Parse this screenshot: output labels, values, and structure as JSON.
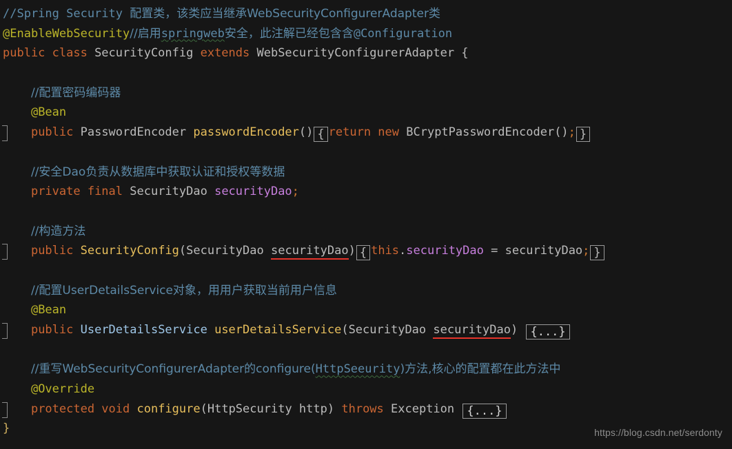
{
  "editor": {
    "background_color": "#161616",
    "default_text_color": "#bcbcbc",
    "language": "java",
    "palette": {
      "comment": "#5d8aa8",
      "keyword": "#cc6633",
      "annotation": "#bbb529",
      "class_name": "#9fc7e8",
      "method_name": "#e8bf5c",
      "field_name": "#c77fdd",
      "plain": "#bcbcbc",
      "error_underline": "#e8342b",
      "spell_underline": "#3d6b3d",
      "fold_border": "#9a9a9a",
      "watermark": "#8c8c8c"
    }
  },
  "code": {
    "lines": [
      {
        "id": "line-1",
        "tokens": [
          {
            "t": "//Spring Security ",
            "c": "cmt"
          },
          {
            "t": "配置类，该类应当继承WebSecurityConfigurerAdapter类",
            "c": "cmt cjk"
          }
        ]
      },
      {
        "id": "line-2",
        "tokens": [
          {
            "t": "@EnableWebSecurity",
            "c": "ann"
          },
          {
            "t": "//启用",
            "c": "cmt cjk"
          },
          {
            "t": "springweb",
            "c": "cmt wavy-green"
          },
          {
            "t": "安全，此注解已经包含含",
            "c": "cmt cjk"
          },
          {
            "t": "@Configuration",
            "c": "cmt"
          }
        ]
      },
      {
        "id": "line-3",
        "tokens": [
          {
            "t": "public class ",
            "c": "kw"
          },
          {
            "t": "SecurityConfig ",
            "c": "plain"
          },
          {
            "t": "extends ",
            "c": "kw"
          },
          {
            "t": "WebSecurityConfigurerAdapter ",
            "c": "plain"
          },
          {
            "t": "{",
            "c": "plain"
          }
        ]
      },
      {
        "id": "line-4",
        "tokens": []
      },
      {
        "id": "line-5",
        "indent": 4,
        "tokens": [
          {
            "t": "//配置密码编码器",
            "c": "cmt cjk"
          }
        ]
      },
      {
        "id": "line-6",
        "indent": 4,
        "tokens": [
          {
            "t": "@Bean",
            "c": "ann"
          }
        ]
      },
      {
        "id": "line-7",
        "indent": 4,
        "fold_marker": true,
        "tokens": [
          {
            "t": "public ",
            "c": "kw"
          },
          {
            "t": "PasswordEncoder ",
            "c": "plain"
          },
          {
            "t": "passwordEncoder",
            "c": "mname"
          },
          {
            "t": "()",
            "c": "plain"
          },
          {
            "t": "{",
            "c": "bracebox"
          },
          {
            "t": "return ",
            "c": "kw"
          },
          {
            "t": "new ",
            "c": "kw"
          },
          {
            "t": "BCryptPasswordEncoder",
            "c": "plain"
          },
          {
            "t": "()",
            "c": "plain"
          },
          {
            "t": ";",
            "c": "semi"
          },
          {
            "t": "}",
            "c": "bracebox"
          }
        ]
      },
      {
        "id": "line-8",
        "tokens": []
      },
      {
        "id": "line-9",
        "indent": 4,
        "tokens": [
          {
            "t": "//安全Dao负责从数据库中获取认证和授权等数据",
            "c": "cmt cjk"
          }
        ]
      },
      {
        "id": "line-10",
        "indent": 4,
        "tokens": [
          {
            "t": "private final ",
            "c": "kw"
          },
          {
            "t": "SecurityDao ",
            "c": "plain"
          },
          {
            "t": "securityDao",
            "c": "fld"
          },
          {
            "t": ";",
            "c": "semi"
          }
        ]
      },
      {
        "id": "line-11",
        "tokens": []
      },
      {
        "id": "line-12",
        "indent": 4,
        "tokens": [
          {
            "t": "//构造方法",
            "c": "cmt cjk"
          }
        ]
      },
      {
        "id": "line-13",
        "indent": 4,
        "fold_marker": true,
        "tokens": [
          {
            "t": "public ",
            "c": "kw"
          },
          {
            "t": "SecurityConfig",
            "c": "mname"
          },
          {
            "t": "(",
            "c": "plain"
          },
          {
            "t": "SecurityDao ",
            "c": "plain"
          },
          {
            "t": "securityDao",
            "c": "plain err-underline"
          },
          {
            "t": ")",
            "c": "plain"
          },
          {
            "t": "{",
            "c": "bracebox"
          },
          {
            "t": "this",
            "c": "kw"
          },
          {
            "t": ".",
            "c": "plain"
          },
          {
            "t": "securityDao",
            "c": "fld"
          },
          {
            "t": " = securityDao",
            "c": "plain"
          },
          {
            "t": ";",
            "c": "semi"
          },
          {
            "t": "}",
            "c": "bracebox"
          }
        ]
      },
      {
        "id": "line-14",
        "tokens": []
      },
      {
        "id": "line-15",
        "indent": 4,
        "tokens": [
          {
            "t": "//配置UserDetailsService对象，用用户获取当前用户信息",
            "c": "cmt cjk"
          }
        ]
      },
      {
        "id": "line-16",
        "indent": 4,
        "tokens": [
          {
            "t": "@Bean",
            "c": "ann"
          }
        ]
      },
      {
        "id": "line-17",
        "indent": 4,
        "fold_marker": true,
        "tokens": [
          {
            "t": "public ",
            "c": "kw"
          },
          {
            "t": "UserDetailsService ",
            "c": "cls"
          },
          {
            "t": "userDetailsService",
            "c": "mname"
          },
          {
            "t": "(",
            "c": "plain"
          },
          {
            "t": "SecurityDao ",
            "c": "plain"
          },
          {
            "t": "securityDao",
            "c": "plain err-underline"
          },
          {
            "t": ") ",
            "c": "plain"
          },
          {
            "t": "{...}",
            "c": "foldbox"
          }
        ]
      },
      {
        "id": "line-18",
        "tokens": []
      },
      {
        "id": "line-19",
        "indent": 4,
        "tokens": [
          {
            "t": "//重写WebSecurityConfigurerAdapter的configure(",
            "c": "cmt cjk"
          },
          {
            "t": "HttpSeeurity",
            "c": "cmt wavy-green2"
          },
          {
            "t": ")方法,核心的配置都在此方法中",
            "c": "cmt cjk"
          }
        ]
      },
      {
        "id": "line-20",
        "indent": 4,
        "tokens": [
          {
            "t": "@Override",
            "c": "ann"
          }
        ]
      },
      {
        "id": "line-21",
        "indent": 4,
        "fold_marker": true,
        "tokens": [
          {
            "t": "protected void ",
            "c": "kw"
          },
          {
            "t": "configure",
            "c": "mname"
          },
          {
            "t": "(",
            "c": "plain"
          },
          {
            "t": "HttpSecurity ",
            "c": "plain"
          },
          {
            "t": "http",
            "c": "plain"
          },
          {
            "t": ") ",
            "c": "plain"
          },
          {
            "t": "throws ",
            "c": "kw"
          },
          {
            "t": "Exception ",
            "c": "plain"
          },
          {
            "t": "{...}",
            "c": "foldbox"
          }
        ]
      },
      {
        "id": "line-22",
        "tokens": [
          {
            "t": "}",
            "c": "brace-y"
          }
        ]
      }
    ]
  },
  "watermark": {
    "text": "https://blog.csdn.net/serdonty"
  }
}
